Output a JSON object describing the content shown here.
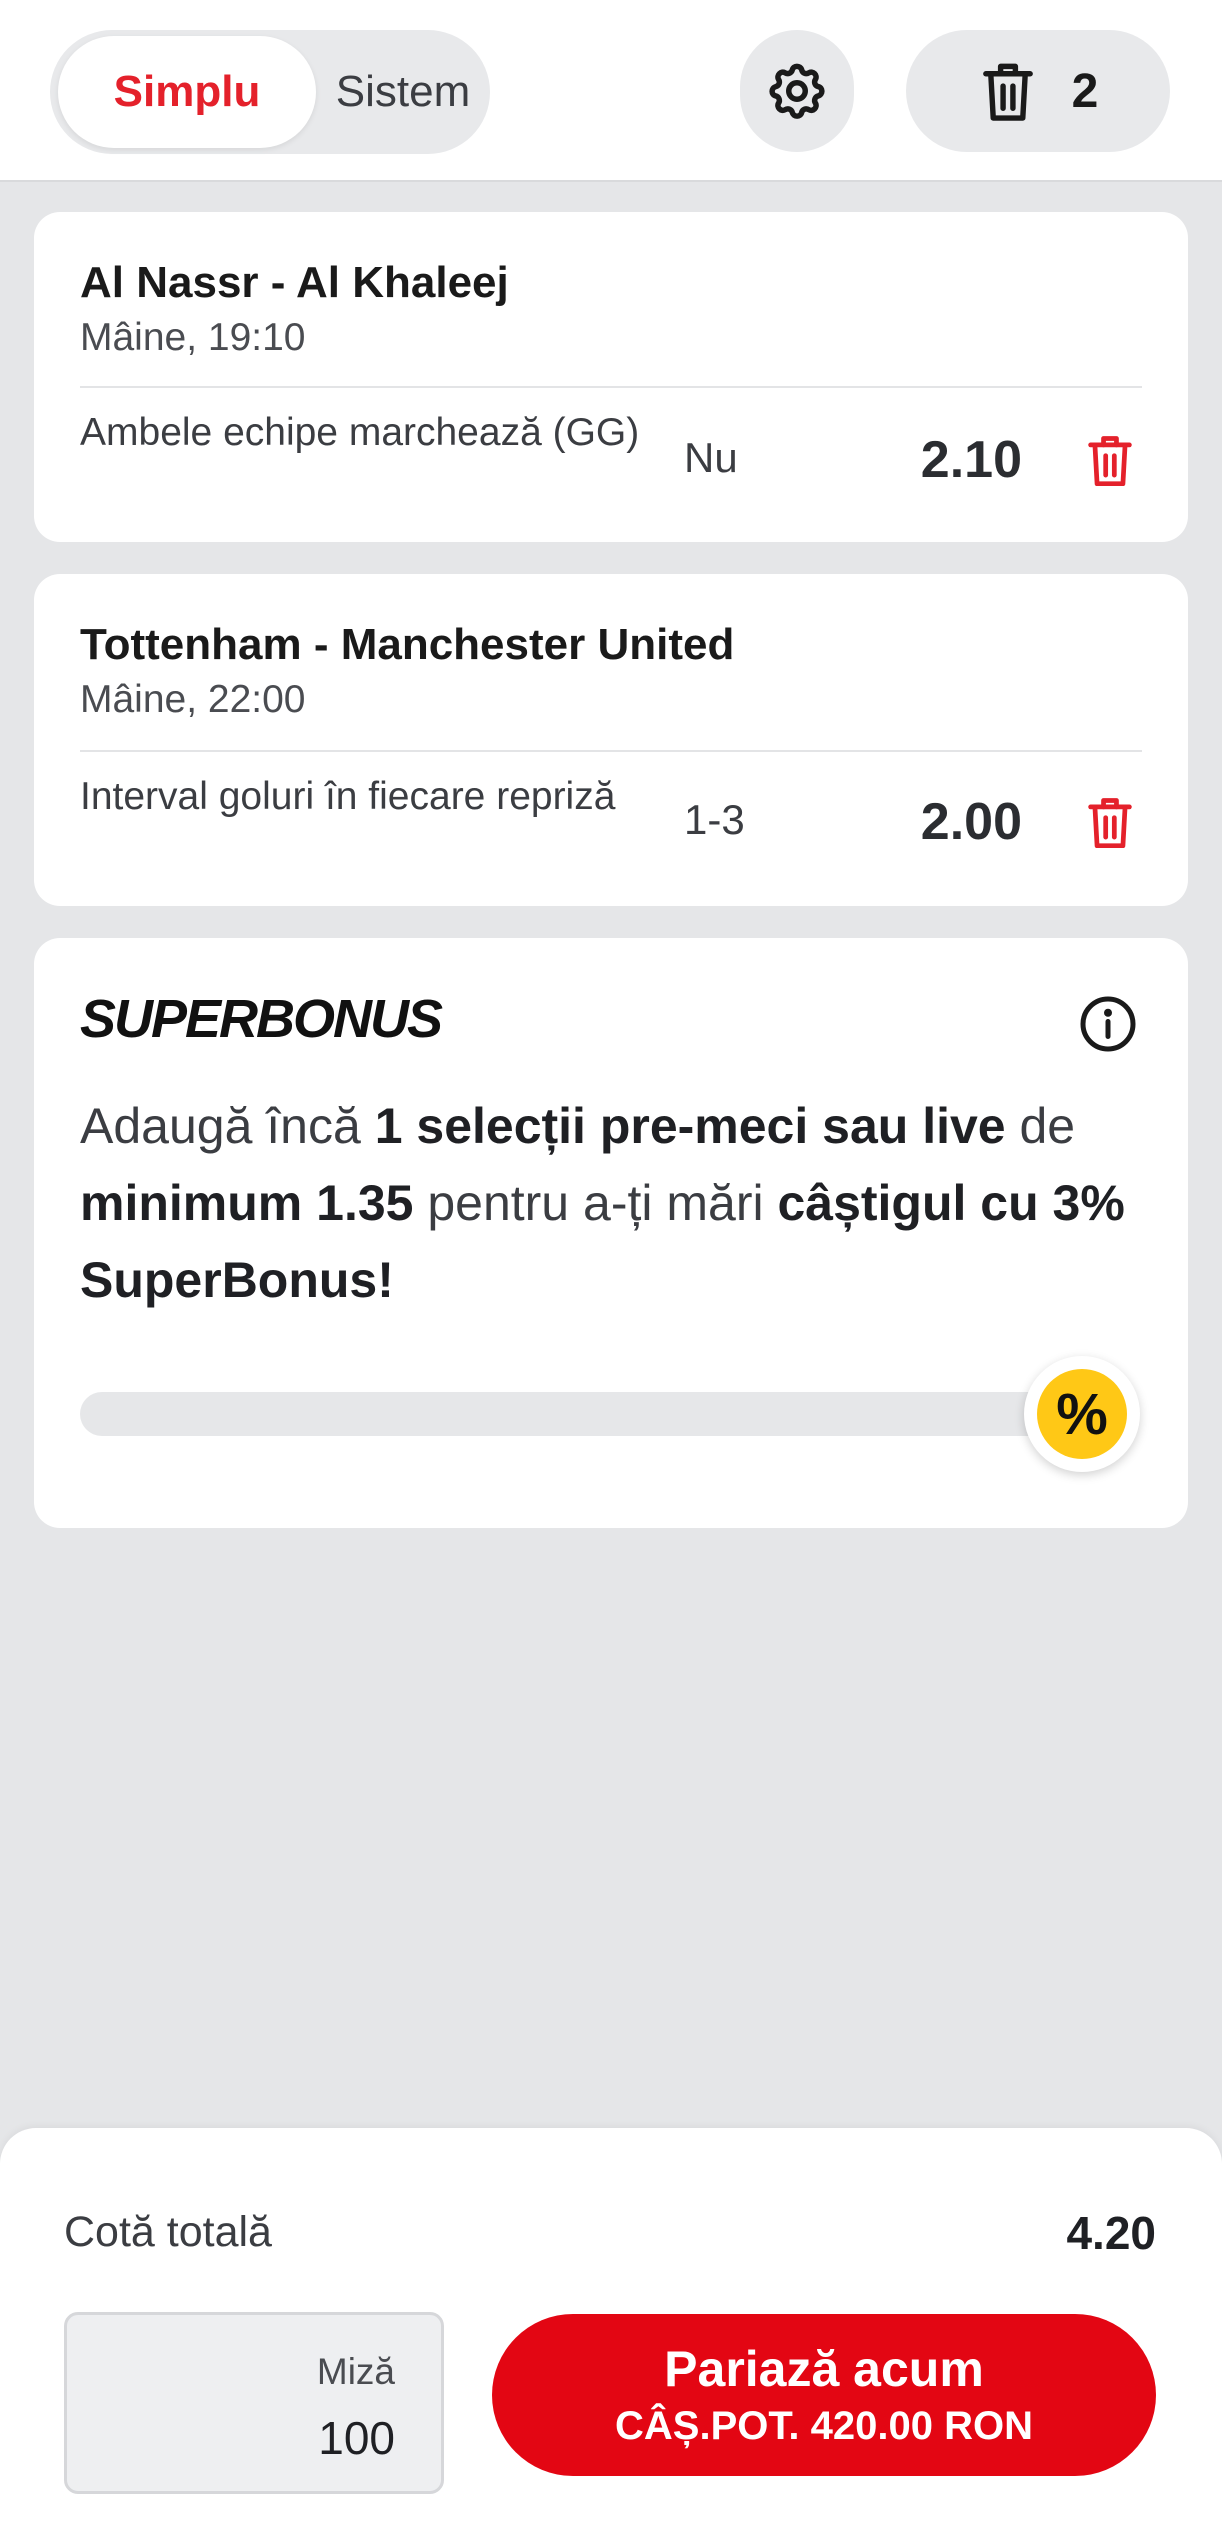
{
  "header": {
    "mode_active": "Simplu",
    "mode_inactive": "Sistem",
    "bet_count": "2"
  },
  "bets": [
    {
      "match": "Al Nassr - Al Khaleej",
      "time": "Mâine, 19:10",
      "market": "Ambele echipe marchează (GG)",
      "selection": "Nu",
      "odds": "2.10"
    },
    {
      "match": "Tottenham - Manchester United",
      "time": "Mâine, 22:00",
      "market": "Interval goluri în fiecare repriză",
      "selection": "1-3",
      "odds": "2.00"
    }
  ],
  "superbonus": {
    "title": "SUPERBONUS",
    "text_1": "Adaugă încă ",
    "text_2": "1 selecții pre-meci sau live",
    "text_3": " de ",
    "text_4": "minimum 1.35",
    "text_5": " pentru a-ți mări ",
    "text_6": "câștigul cu 3% SuperBonus!",
    "badge": "%",
    "progress": 0
  },
  "footer": {
    "total_label": "Cotă totală",
    "total_value": "4.20",
    "stake_label": "Miză",
    "stake_value": "100",
    "bet_button_main": "Pariază acum",
    "bet_button_sub": "CÂȘ.POT. 420.00 RON"
  },
  "colors": {
    "accent_red": "#e30613",
    "active_tab_red": "#e4212b",
    "superbonus_yellow": "#ffc816",
    "background": "#e5e6e8"
  },
  "icons": {
    "settings": "gear-icon",
    "clear_all": "trash-icon",
    "remove_bet": "trash-icon",
    "info": "info-icon"
  }
}
